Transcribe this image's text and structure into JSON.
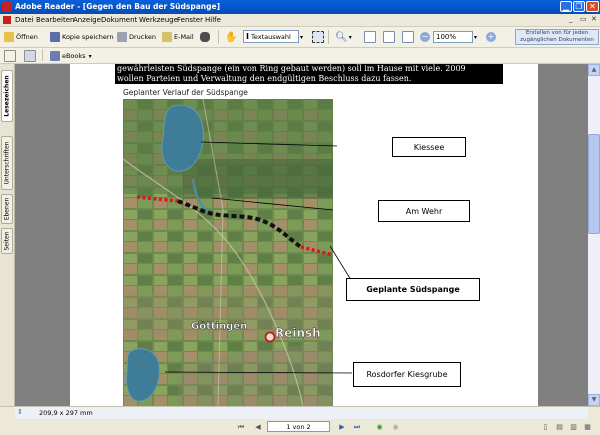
{
  "window": {
    "title": "Adobe Reader - [Gegen den Bau der Südspange]"
  },
  "menu": {
    "items": [
      "Datei",
      "Bearbeiten",
      "Anzeige",
      "Dokument",
      "Werkzeuge",
      "Fenster",
      "Hilfe"
    ]
  },
  "toolbar": {
    "open_label": "Öffnen",
    "save_copy_label": "Kopie speichern",
    "print_label": "Drucken",
    "email_label": "E-Mail",
    "text_select_label": "Textauswahl",
    "zoom_value": "100%",
    "create_accessible_label": "Erstellen von für jeden zugänglichen Dokumenten",
    "ebooks_label": "eBooks"
  },
  "side_tabs": [
    "Lesezeichen",
    "Unterschriften",
    "Ebenen",
    "Seiten"
  ],
  "document": {
    "top_text_line1": "gewährleisten Südspange (ein von Ring gebaut werden) soll im Hause mit viele. 2009",
    "top_text_line2": "wollen Parteien und Verwaltung den endgültigen Beschluss dazu fassen.",
    "caption": "Geplanter Verlauf der Südspange",
    "map_label_1": "Göttingen",
    "map_label_2": "Reinsh",
    "callouts": [
      "Kiessee",
      "Am Wehr",
      "Geplante Südspange",
      "Rosdorfer Kiesgrube"
    ]
  },
  "status": {
    "page_size": "209,9 x 297 mm",
    "page_indicator": "1 von 2"
  },
  "colors": {
    "title_bar": "#0453c8",
    "close_button": "#d94d24",
    "route_dashes": "#d61919",
    "route_planned": "#111111"
  }
}
